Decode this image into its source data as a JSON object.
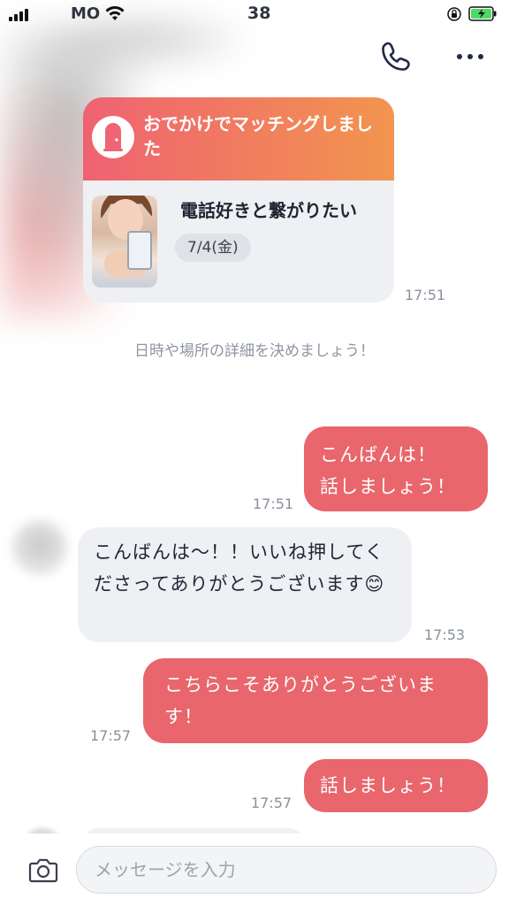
{
  "status_bar": {
    "carrier": "MO",
    "time": "38"
  },
  "match_card": {
    "title": "おでかけでマッチングしました",
    "plan_title": "電話好きと繋がりたい",
    "date": "7/4(金)",
    "time": "17:51"
  },
  "system_message": "日時や場所の詳細を決めましょう！",
  "messages": [
    {
      "direction": "out",
      "text": "こんばんは！\n話しましょう！",
      "time": "17:51"
    },
    {
      "direction": "in",
      "text": "こんばんは〜！！いいね押してくださってありがとうございます😊",
      "time": "17:53"
    },
    {
      "direction": "out",
      "text": "こちらこそありがとうございます！",
      "time": "17:57"
    },
    {
      "direction": "out",
      "text": "話しましょう！",
      "time": "17:57"
    }
  ],
  "input": {
    "placeholder": "メッセージを入力"
  },
  "icons": {
    "call": "phone-icon",
    "menu": "more-icon",
    "camera": "camera-icon",
    "match_badge": "door-icon"
  },
  "colors": {
    "outgoing_bubble": "#e8666c",
    "incoming_bubble": "#eef0f3",
    "card_gradient_start": "#ef6272",
    "card_gradient_end": "#f2954f"
  }
}
